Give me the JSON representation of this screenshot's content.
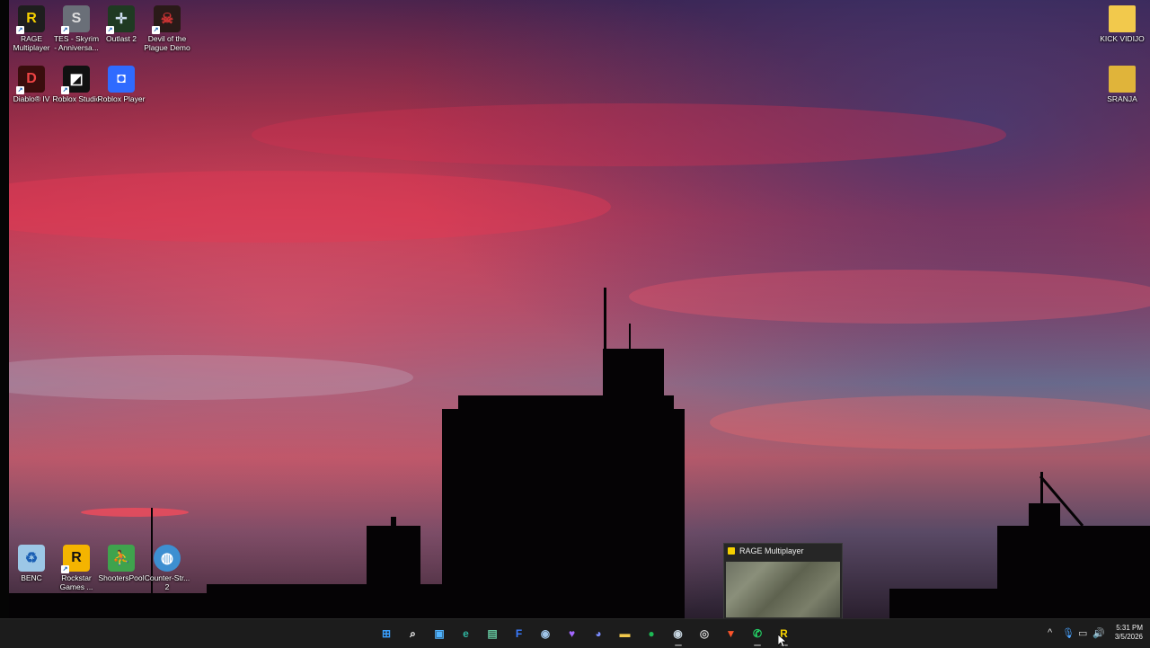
{
  "desktop": {
    "icons_top_left": [
      {
        "label": "RAGE Multiplayer",
        "icon": "rage-mp-icon",
        "color": "#1e1e1e"
      },
      {
        "label": "TES - Skyrim - Anniversa...",
        "icon": "skyrim-icon",
        "color": "#6a6f78"
      },
      {
        "label": "Outlast 2",
        "icon": "outlast-icon",
        "color": "#1f3a22"
      },
      {
        "label": "Devil of the Plague Demo",
        "icon": "devil-plague-icon",
        "color": "#2a1a18"
      },
      {
        "label": "Diablo® IV",
        "icon": "diablo-icon",
        "color": "#3a0d0d"
      },
      {
        "label": "Roblox Studio",
        "icon": "roblox-studio-icon",
        "color": "#111111"
      },
      {
        "label": "Roblox Player",
        "icon": "roblox-player-icon",
        "color": "#2f6bff"
      }
    ],
    "icons_right": [
      {
        "label": "KICK VIDIJO",
        "icon": "folder-icon",
        "color": "#f2c94c"
      },
      {
        "label": "SRANJA",
        "icon": "folder-icon",
        "color": "#e0b43a"
      }
    ],
    "icons_bottom_left": [
      {
        "label": "BENC",
        "icon": "recycle-bin-icon",
        "color": "#9cc7e6"
      },
      {
        "label": "Rockstar Games ...",
        "icon": "rockstar-icon",
        "color": "#f4b400"
      },
      {
        "label": "ShootersPool",
        "icon": "shooterspool-icon",
        "color": "#3fa34d"
      },
      {
        "label": "Counter-Str... 2",
        "icon": "counter-strike-icon",
        "color": "#3d8fd1"
      }
    ]
  },
  "taskbar_preview": {
    "title": "RAGE Multiplayer",
    "icon": "rage-mp-icon"
  },
  "taskbar": {
    "apps": [
      {
        "name": "start-icon",
        "glyph": "⊞",
        "color": "#3aa0ff",
        "active": false
      },
      {
        "name": "search-icon",
        "glyph": "⌕",
        "color": "#ffffff",
        "active": false
      },
      {
        "name": "task-view-icon",
        "glyph": "▣",
        "color": "#4fb3ff",
        "active": false
      },
      {
        "name": "edge-icon",
        "glyph": "e",
        "color": "#2fb5a0",
        "active": false
      },
      {
        "name": "files-app-icon",
        "glyph": "▤",
        "color": "#63c29b",
        "active": false
      },
      {
        "name": "f-app-icon",
        "glyph": "F",
        "color": "#3a7bff",
        "active": false
      },
      {
        "name": "steam-icon-1",
        "glyph": "◉",
        "color": "#9fc4e8",
        "active": false
      },
      {
        "name": "heart-app-icon",
        "glyph": "♥",
        "color": "#a367ff",
        "active": false
      },
      {
        "name": "discord-icon",
        "glyph": "◕",
        "color": "#7a8cff",
        "active": false
      },
      {
        "name": "file-explorer-icon",
        "glyph": "▬",
        "color": "#f2c94c",
        "active": false
      },
      {
        "name": "spotify-icon",
        "glyph": "●",
        "color": "#1db954",
        "active": false
      },
      {
        "name": "steam-icon-2",
        "glyph": "◉",
        "color": "#c7d5e0",
        "active": true
      },
      {
        "name": "obs-icon",
        "glyph": "◎",
        "color": "#cccccc",
        "active": false
      },
      {
        "name": "brave-icon",
        "glyph": "▼",
        "color": "#fb542b",
        "active": false
      },
      {
        "name": "whatsapp-icon",
        "glyph": "✆",
        "color": "#25d366",
        "active": true
      },
      {
        "name": "rage-mp-taskbar-icon",
        "glyph": "R",
        "color": "#f5d000",
        "active": true
      }
    ],
    "tray": {
      "chevron": "^",
      "time": "5:31 PM",
      "date": "3/5/2026"
    }
  }
}
